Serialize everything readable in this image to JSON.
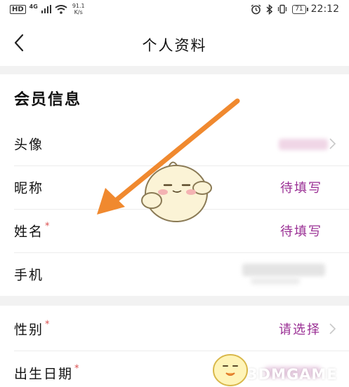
{
  "status_bar": {
    "hd": "HD",
    "network": "4G",
    "speed_value": "91.1",
    "speed_unit": "K/s",
    "battery": "71",
    "time": "22:12"
  },
  "header": {
    "title": "个人资料"
  },
  "member_section": {
    "title": "会员信息",
    "rows": [
      {
        "label": "头像",
        "value": ""
      },
      {
        "label": "昵称",
        "value": "待填写"
      },
      {
        "label": "姓名",
        "value": "待填写",
        "required": "*"
      },
      {
        "label": "手机",
        "value": ""
      }
    ]
  },
  "profile_section": {
    "rows": [
      {
        "label": "性别",
        "value": "请选择",
        "required": "*"
      },
      {
        "label": "出生日期",
        "value": "",
        "required": "*"
      }
    ]
  },
  "watermark": "3DMGAME",
  "colors": {
    "accent": "#9a2f94",
    "required": "#d94a4a",
    "arrow": "#f0892f",
    "gap": "#f2f2f2"
  }
}
